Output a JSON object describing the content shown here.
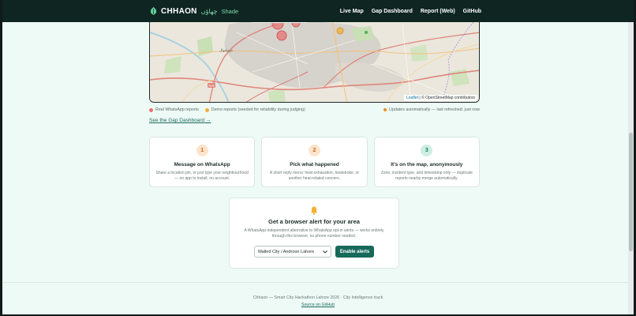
{
  "navbar": {
    "brand_name": "CHHAON",
    "brand_urdu": "چھاؤں",
    "brand_tag": "Shade",
    "links": [
      "Live Map",
      "Gap Dashboard",
      "Report (Web)",
      "GitHub"
    ]
  },
  "map": {
    "attribution_leaflet": "Leaflet",
    "attribution_rest": "| © OpenStreetMap contributors",
    "place_labels": [
      "N-5",
      "موہلنوال"
    ]
  },
  "legend": {
    "real": "Real WhatsApp reports",
    "demo": "Demo reports (seeded for reliability during judging)",
    "status": "Updates automatically — last refreshed: just now"
  },
  "gap_link": "See the Gap Dashboard →",
  "steps": [
    {
      "num": "1",
      "title": "Message on WhatsApp",
      "desc": "Share a location pin, or just type your neighbourhood — no app to install, no account."
    },
    {
      "num": "2",
      "title": "Pick what happened",
      "desc": "A short reply menu: heat exhaustion, heatstroke, or another heat-related concern."
    },
    {
      "num": "3",
      "title": "It's on the map, anonymously",
      "desc": "Zone, incident type, and timestamp only — duplicate reports nearby merge automatically."
    }
  ],
  "alert": {
    "title": "Get a browser alert for your area",
    "desc": "A WhatsApp-independent alternative to WhatsApp opt-in alerts — works entirely through this browser, no phone number needed.",
    "selected_area": "Walled City / Androon Lahore",
    "button": "Enable alerts"
  },
  "footer": {
    "text": "Chhaon — Smart City Hackathon Lahore 2026 · City Intelligence track",
    "link": "Source on GitHub"
  },
  "colors": {
    "navbar_bg": "#0e2521",
    "accent": "#17695a",
    "real_dot": "#e57373",
    "demo_dot": "#f0b040",
    "page_bg": "#eefaf6"
  }
}
